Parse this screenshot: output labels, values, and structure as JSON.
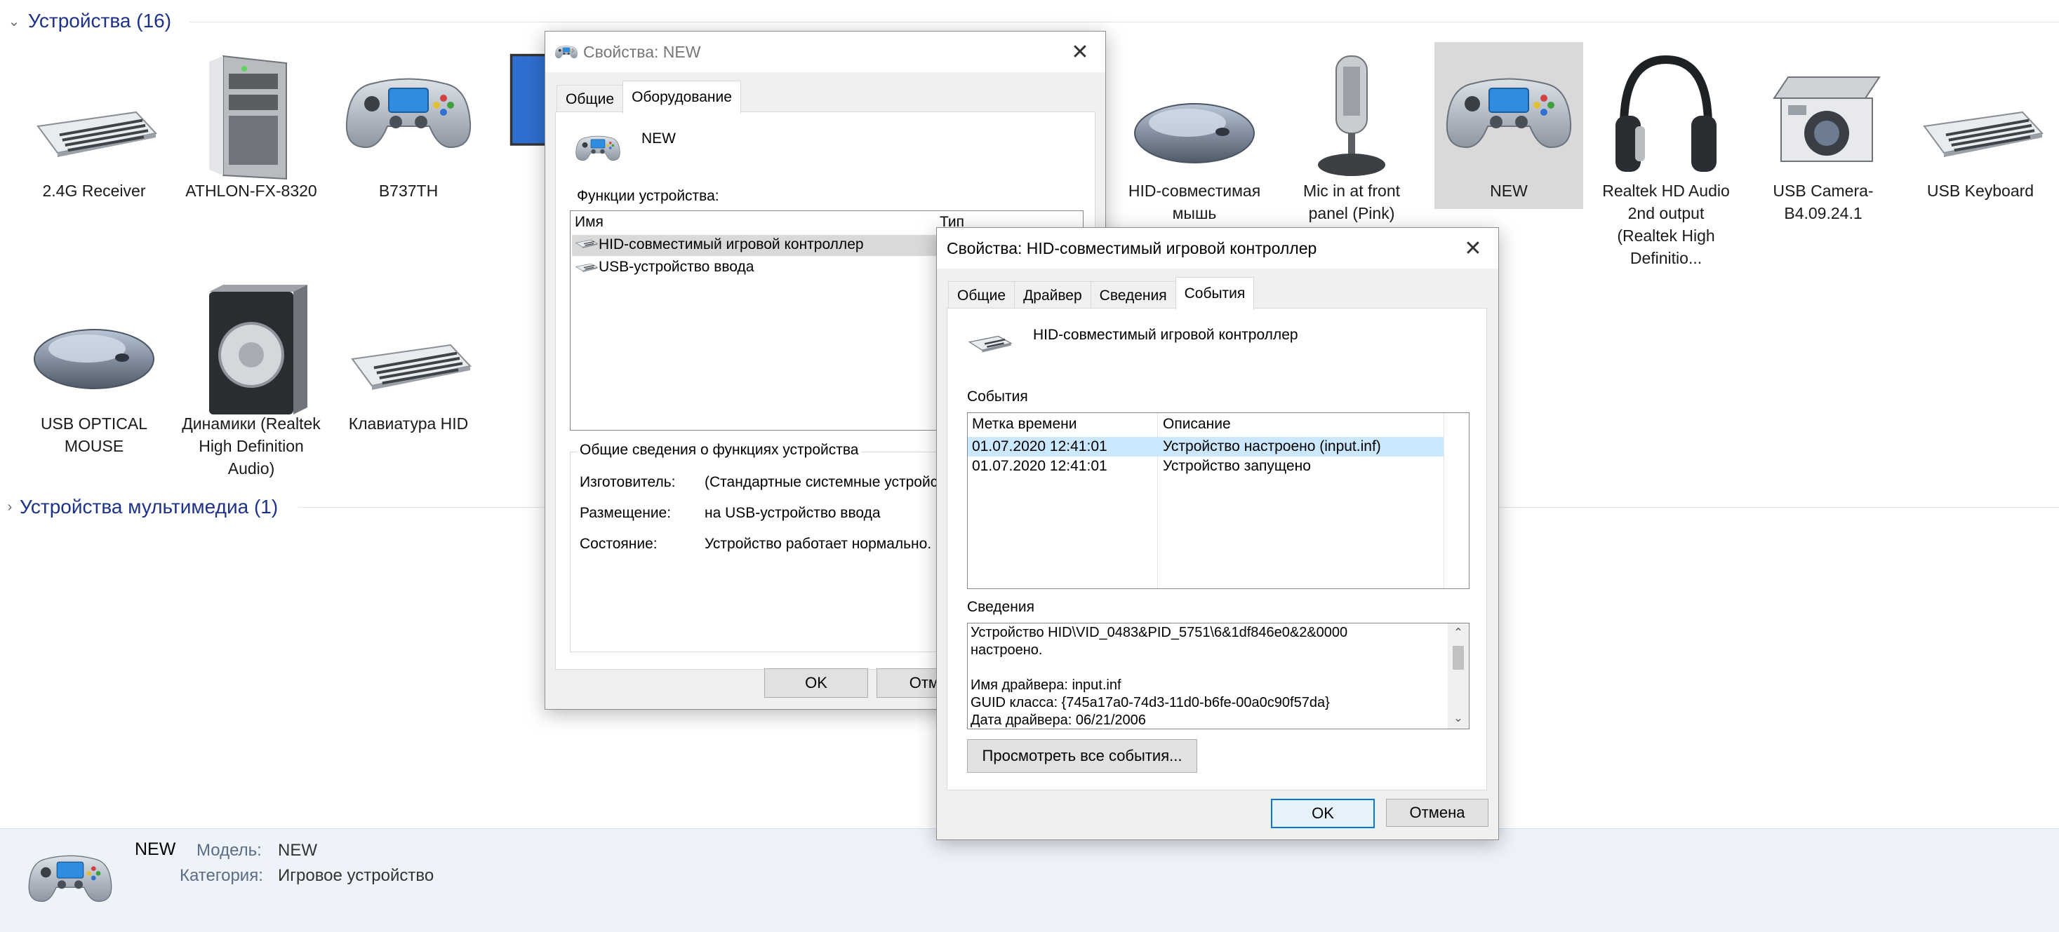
{
  "groups": [
    {
      "label": "Устройства (16)"
    },
    {
      "label": "Устройства мультимедиа (1)"
    }
  ],
  "devices": [
    {
      "label": "2.4G Receiver"
    },
    {
      "label": "ATHLON-FX-8320"
    },
    {
      "label": "B737TH"
    },
    {
      "label": "HID-совместимая мышь"
    },
    {
      "label": "Mic in at front panel (Pink)"
    },
    {
      "label": "NEW"
    },
    {
      "label": "Realtek HD Audio 2nd output (Realtek High Definitio..."
    },
    {
      "label": "USB Camera-B4.09.24.1"
    },
    {
      "label": "USB Keyboard"
    },
    {
      "label": "USB OPTICAL MOUSE"
    },
    {
      "label": "Динамики (Realtek High Definition Audio)"
    },
    {
      "label": "Клавиатура HID"
    }
  ],
  "details": {
    "name": "NEW",
    "model_label": "Модель:",
    "model_value": "NEW",
    "category_label": "Категория:",
    "category_value": "Игровое устройство"
  },
  "dialog_new": {
    "title": "Свойства: NEW",
    "tabs": [
      "Общие",
      "Оборудование"
    ],
    "device_name": "NEW",
    "functions_label": "Функции устройства:",
    "columns": [
      "Имя",
      "Тип"
    ],
    "rows": [
      "HID-совместимый игровой контроллер",
      "USB-устройство ввода"
    ],
    "summary_title": "Общие сведения о функциях устройства",
    "manufacturer_label": "Изготовитель:",
    "manufacturer_value": "(Стандартные системные устройс",
    "location_label": "Размещение:",
    "location_value": "на USB-устройство ввода",
    "status_label": "Состояние:",
    "status_value": "Устройство работает нормально.",
    "ok": "OK",
    "cancel": "Отме"
  },
  "dialog_hid": {
    "title": "Свойства: HID-совместимый игровой контроллер",
    "tabs": [
      "Общие",
      "Драйвер",
      "Сведения",
      "События"
    ],
    "device_name": "HID-совместимый игровой контроллер",
    "events_label": "События",
    "columns": [
      "Метка времени",
      "Описание"
    ],
    "events": [
      {
        "time": "01.07.2020 12:41:01",
        "desc": "Устройство настроено (input.inf)"
      },
      {
        "time": "01.07.2020 12:41:01",
        "desc": "Устройство запущено"
      }
    ],
    "info_label": "Сведения",
    "info_lines": [
      "Устройство HID\\VID_0483&PID_5751\\6&1df846e0&2&0000",
      "настроено.",
      "",
      "Имя драйвера: input.inf",
      "GUID класса: {745a17a0-74d3-11d0-b6fe-00a0c90f57da}",
      "Дата драйвера: 06/21/2006"
    ],
    "view_all": "Просмотреть все события...",
    "ok": "OK",
    "cancel": "Отмена"
  },
  "icons": {
    "chevron_down": "chevron-down-icon",
    "chevron_right": "chevron-right-icon",
    "close": "close-icon",
    "gamepad": "gamepad-icon",
    "hid": "hid-device-icon"
  }
}
